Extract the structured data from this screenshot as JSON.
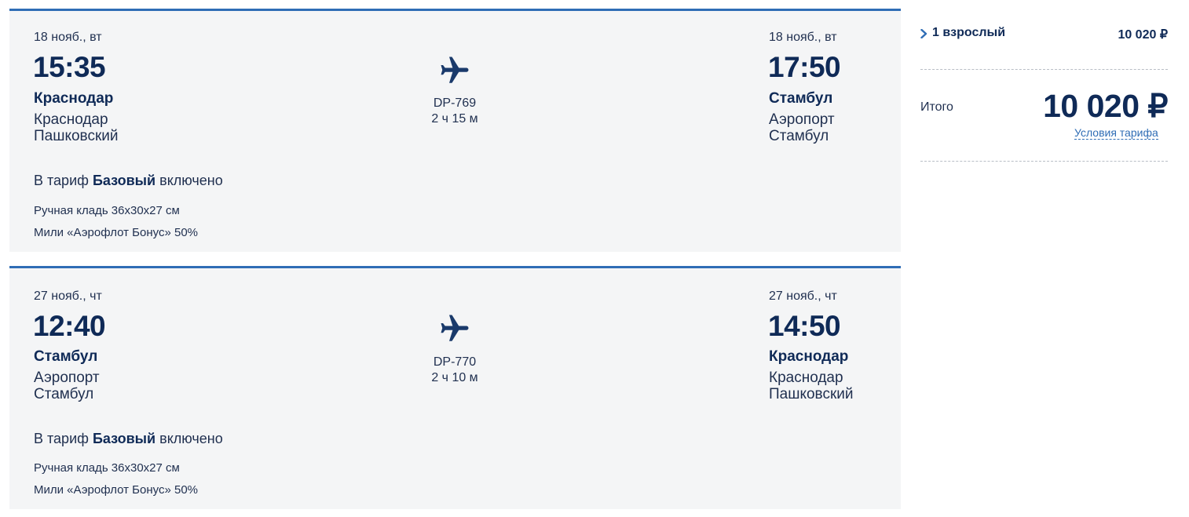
{
  "segments": [
    {
      "departure": {
        "date": "18 нояб., вт",
        "time": "15:35",
        "city": "Краснодар",
        "airport": "Краснодар\nПашковский"
      },
      "flight": {
        "number": "DP-769",
        "duration": "2 ч 15 м",
        "icon": "airplane-icon"
      },
      "arrival": {
        "date": "18 нояб., вт",
        "time": "17:50",
        "city": "Стамбул",
        "airport": "Аэропорт\nСтамбул"
      },
      "tariff": {
        "prefix": "В тариф",
        "name": "Базовый",
        "suffix": "включено",
        "features": [
          "Ручная кладь 36x30x27 см",
          "Мили «Аэрофлот Бонус» 50%"
        ]
      }
    },
    {
      "departure": {
        "date": "27 нояб., чт",
        "time": "12:40",
        "city": "Стамбул",
        "airport": "Аэропорт\nСтамбул"
      },
      "flight": {
        "number": "DP-770",
        "duration": "2 ч 10 м",
        "icon": "airplane-icon"
      },
      "arrival": {
        "date": "27 нояб., чт",
        "time": "14:50",
        "city": "Краснодар",
        "airport": "Краснодар\nПашковский"
      },
      "tariff": {
        "prefix": "В тариф",
        "name": "Базовый",
        "suffix": "включено",
        "features": [
          "Ручная кладь 36x30x27 см",
          "Мили «Аэрофлот Бонус» 50%"
        ]
      }
    }
  ],
  "summary": {
    "passengers_label": "1 взрослый",
    "passengers_price": "10 020 ₽",
    "total_label": "Итого",
    "total_amount": "10 020 ₽",
    "conditions_link": "Условия тарифа"
  },
  "colors": {
    "accent": "#2f6db5",
    "dark_text": "#0f2a57",
    "card_bg": "#f4f5f6"
  }
}
